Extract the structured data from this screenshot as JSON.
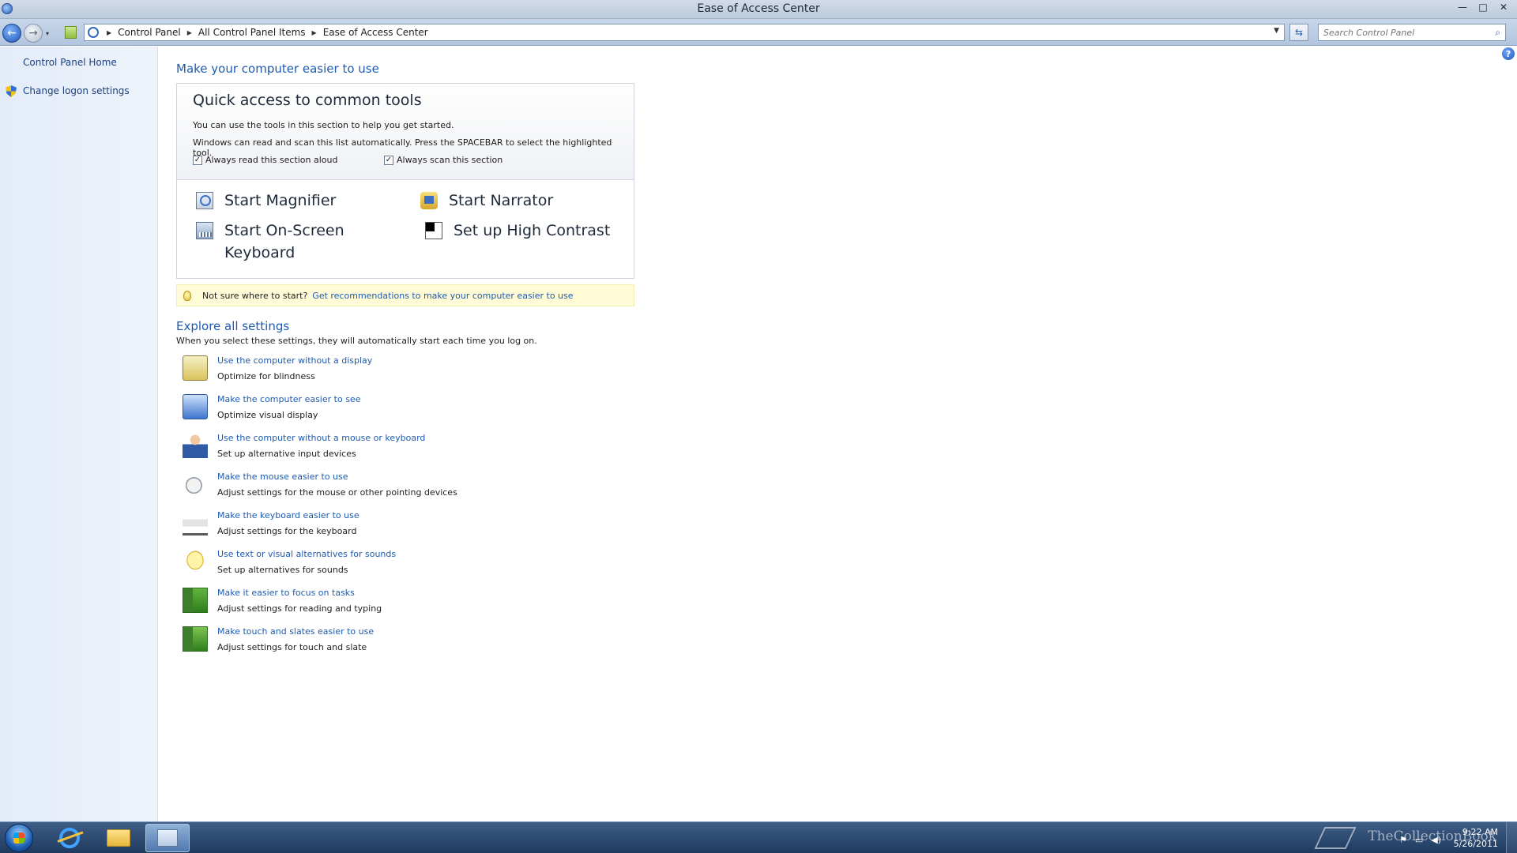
{
  "window": {
    "title": "Ease of Access Center",
    "controls": {
      "minimize": "—",
      "maximize": "□",
      "close": "✕"
    }
  },
  "address": {
    "crumbs": [
      "Control Panel",
      "All Control Panel Items",
      "Ease of Access Center"
    ],
    "separator": "▶",
    "dropdown": "▼",
    "refresh": "⇆",
    "search_placeholder": "Search Control Panel",
    "search_icon": "⌕",
    "back": "←",
    "forward": "→",
    "history": "▾"
  },
  "left_pane": {
    "home_link": "Control Panel Home",
    "logon_link": "Change logon settings"
  },
  "help": "?",
  "main": {
    "title": "Make your computer easier to use",
    "quick": {
      "title": "Quick access to common tools",
      "line1": "You can use the tools in this section to help you get started.",
      "line2": "Windows can read and scan this list automatically.  Press the SPACEBAR to select the highlighted tool.",
      "read_aloud": {
        "label": "Always read this section aloud",
        "checked": "✓"
      },
      "scan": {
        "label": "Always scan this section",
        "checked": "✓"
      },
      "tools": {
        "magnifier": "Start Magnifier",
        "narrator": "Start Narrator",
        "keyboard_l1": "Start On-Screen",
        "keyboard_l2": "Keyboard",
        "contrast": "Set up High Contrast"
      }
    },
    "tip": {
      "text": "Not sure where to start?",
      "link": "Get recommendations to make your computer easier to use"
    },
    "explore": {
      "title": "Explore all settings",
      "subtitle": "When you select these settings, they will automatically start each time you log on.",
      "items": [
        {
          "link": "Use the computer without a display",
          "desc": "Optimize for blindness"
        },
        {
          "link": "Make the computer easier to see",
          "desc": "Optimize visual display"
        },
        {
          "link": "Use the computer without a mouse or keyboard",
          "desc": "Set up alternative input devices"
        },
        {
          "link": "Make the mouse easier to use",
          "desc": "Adjust settings for the mouse or other pointing devices"
        },
        {
          "link": "Make the keyboard easier to use",
          "desc": "Adjust settings for the keyboard"
        },
        {
          "link": "Use text or visual alternatives for sounds",
          "desc": "Set up alternatives for sounds"
        },
        {
          "link": "Make it easier to focus on tasks",
          "desc": "Adjust settings for reading and typing"
        },
        {
          "link": "Make touch and slates easier to use",
          "desc": "Adjust settings for touch and slate"
        }
      ]
    }
  },
  "taskbar": {
    "watermark": "TheCollectionBook",
    "time": "9:22 AM",
    "date": "5/26/2011",
    "tray_icons": [
      "⚑",
      "▭",
      "◀)"
    ]
  }
}
